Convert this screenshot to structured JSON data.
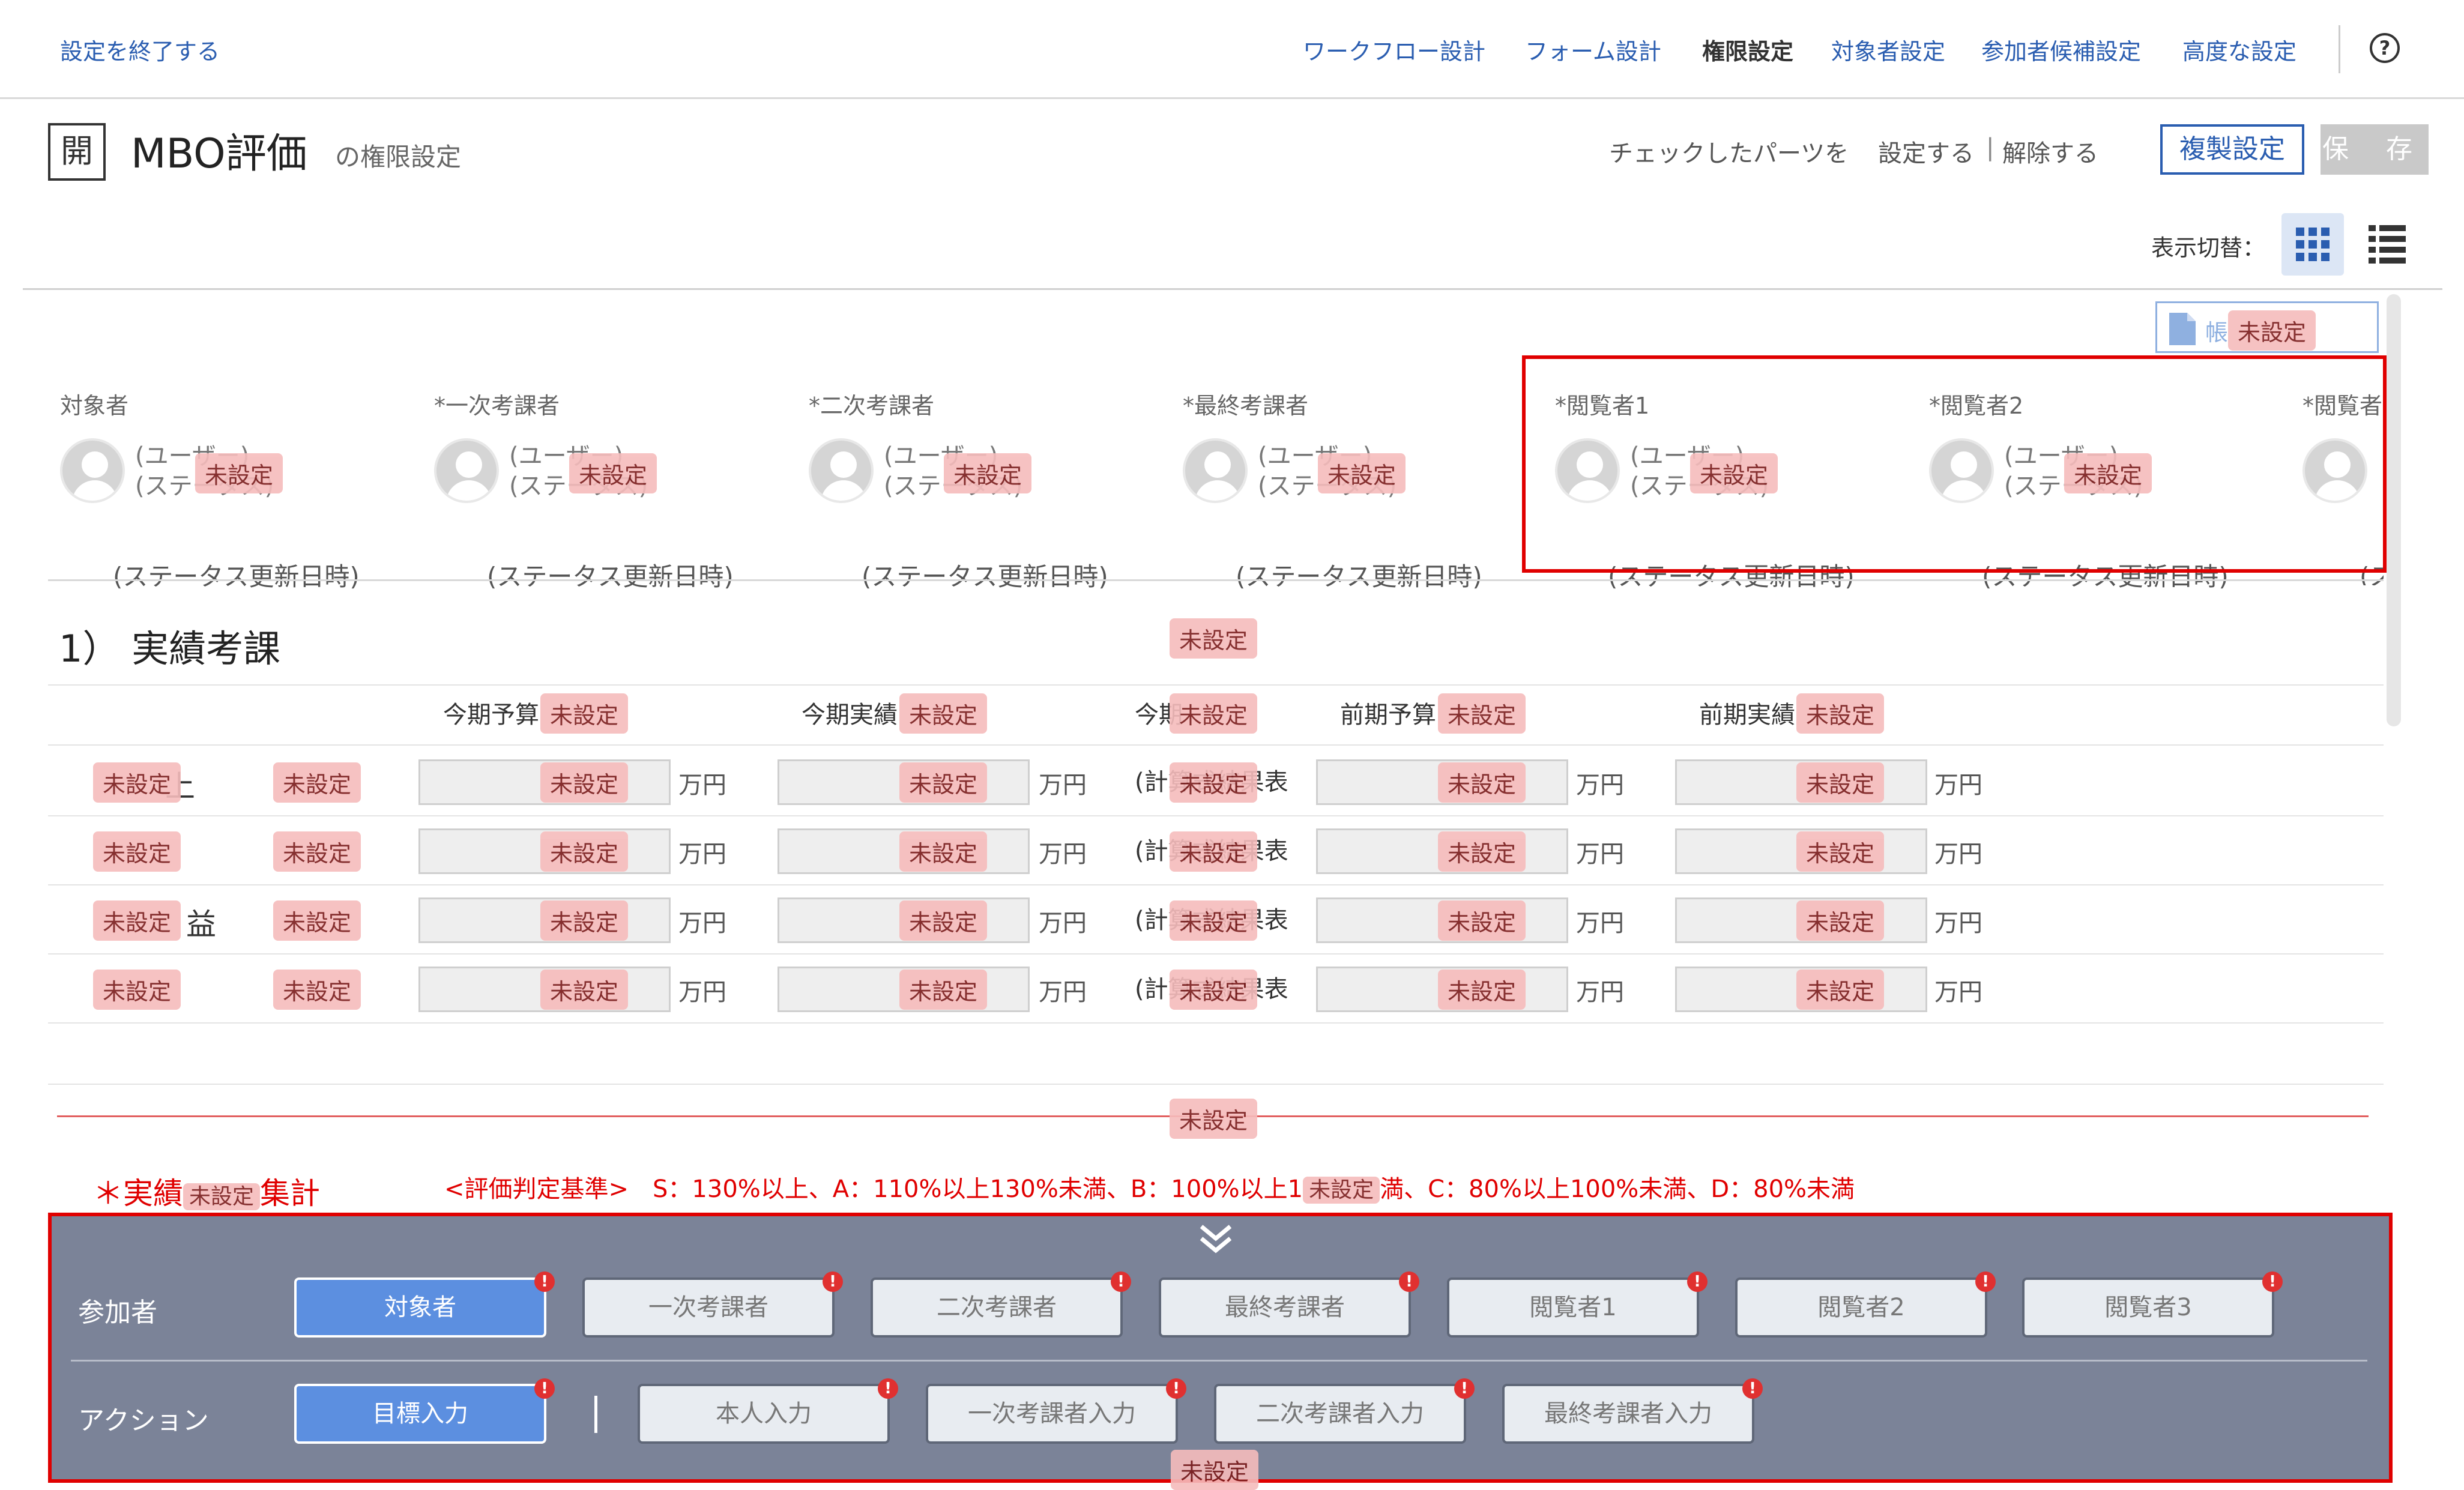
{
  "topbar": {
    "exit_label": "設定を終了する",
    "nav": [
      "ワークフロー設計",
      "フォーム設計",
      "権限設定",
      "対象者設定",
      "参加者候補設定",
      "高度な設定"
    ],
    "help_label": "?"
  },
  "title": {
    "badge": "開",
    "name": "MBO評価",
    "suffix": "の権限設定"
  },
  "actions": {
    "check_text": "チェックしたパーツを",
    "set_label": "設定する",
    "separator": "|",
    "unset_label": "解除する",
    "copy_label": "複製設定",
    "save_label": "保 存"
  },
  "view_toggle": {
    "label": "表示切替："
  },
  "badge_text": "未設定",
  "doc_button": {
    "label": "帳"
  },
  "participants": [
    {
      "role": "対象者",
      "user": "(ユーザー)",
      "status": "(ステータス)",
      "date": "(ステータス更新日時)"
    },
    {
      "role": "*一次考課者",
      "user": "(ユーザー)",
      "status": "(ステータス)",
      "date": "(ステータス更新日時)"
    },
    {
      "role": "*二次考課者",
      "user": "(ユーザー)",
      "status": "(ステータス)",
      "date": "(ステータス更新日時)"
    },
    {
      "role": "*最終考課者",
      "user": "(ユーザー)",
      "status": "(ステータス)",
      "date": "(ステータス更新日時)"
    },
    {
      "role": "*閲覧者1",
      "user": "(ユーザー)",
      "status": "(ステータス)",
      "date": "(ステータス更新日時)"
    },
    {
      "role": "*閲覧者2",
      "user": "(ユーザー)",
      "status": "(ステータス)",
      "date": "(ステータス更新日時)"
    },
    {
      "role": "*閲覧者",
      "user": "",
      "status": "",
      "date": "(ス"
    }
  ],
  "section": {
    "title": "1） 実績考課",
    "columns": [
      "今期予算",
      "今期実績",
      "今期",
      "前期予算",
      "前期実績"
    ],
    "unit": "万円",
    "calc_text": "(計算式結果表",
    "row_labels": [
      "上",
      "",
      "益",
      ""
    ]
  },
  "evaluation": {
    "label_prefix": "＊実績",
    "label_suffix": "集計",
    "criteria_a": "<評価判定基準>　S：130%以上、A：110%以上130%未満、B：100%以上1",
    "criteria_b": "満、C：80%以上100%未満、D：80%未満"
  },
  "panel": {
    "participants_label": "参加者",
    "actions_label": "アクション",
    "separator": "|",
    "participant_chips": [
      "対象者",
      "一次考課者",
      "二次考課者",
      "最終考課者",
      "閲覧者1",
      "閲覧者2",
      "閲覧者3"
    ],
    "action_chips": [
      "目標入力",
      "本人入力",
      "一次考課者入力",
      "二次考課者入力",
      "最終考課者入力"
    ],
    "alert": "!"
  }
}
